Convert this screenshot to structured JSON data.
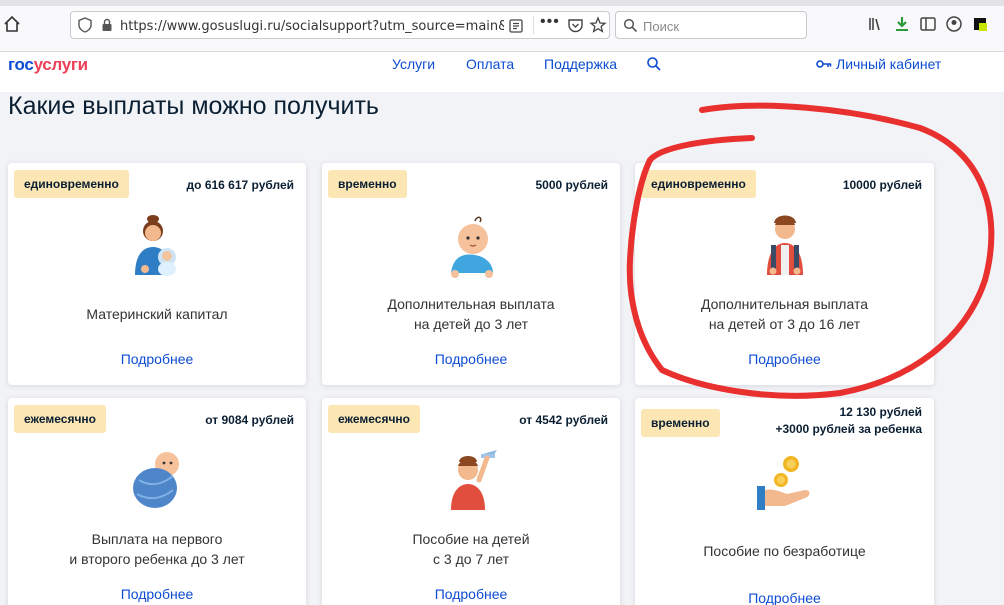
{
  "browser": {
    "url": "https://www.gosuslugi.ru/socialsupport?utm_source=main&utm_medium=",
    "search_placeholder": "Поиск"
  },
  "header": {
    "logo_part1": "гос",
    "logo_part2": "услуги",
    "nav": [
      "Услуги",
      "Оплата",
      "Поддержка"
    ],
    "cabinet": "Личный кабинет"
  },
  "page": {
    "title": "Какие выплаты можно получить"
  },
  "cards": [
    {
      "badge": "единовременно",
      "amount": "до 616 617 рублей",
      "title_line1": "Материнский капитал",
      "title_line2": "",
      "link": "Подробнее"
    },
    {
      "badge": "временно",
      "amount": "5000 рублей",
      "title_line1": "Дополнительная выплата",
      "title_line2": "на детей до 3 лет",
      "link": "Подробнее"
    },
    {
      "badge": "единовременно",
      "amount": "10000 рублей",
      "title_line1": "Дополнительная выплата",
      "title_line2": "на детей от 3 до 16 лет",
      "link": "Подробнее"
    },
    {
      "badge": "ежемесячно",
      "amount": "от 9084 рублей",
      "title_line1": "Выплата на первого",
      "title_line2": "и второго ребенка до 3 лет",
      "link": "Подробнее"
    },
    {
      "badge": "ежемесячно",
      "amount": "от 4542 рублей",
      "title_line1": "Пособие на детей",
      "title_line2": "с 3 до 7 лет",
      "link": "Подробнее"
    },
    {
      "badge": "временно",
      "amount": "12 130 рублей",
      "amount_line2": "+3000 рублей за ребенка",
      "title_line1": "Пособие по безработице",
      "title_line2": "",
      "link": "Подробнее"
    }
  ],
  "colors": {
    "accent": "#0d4cd3",
    "brand_red": "#ee3f58",
    "badge_bg": "#fbe6b4",
    "annotation": "#e8302f"
  }
}
